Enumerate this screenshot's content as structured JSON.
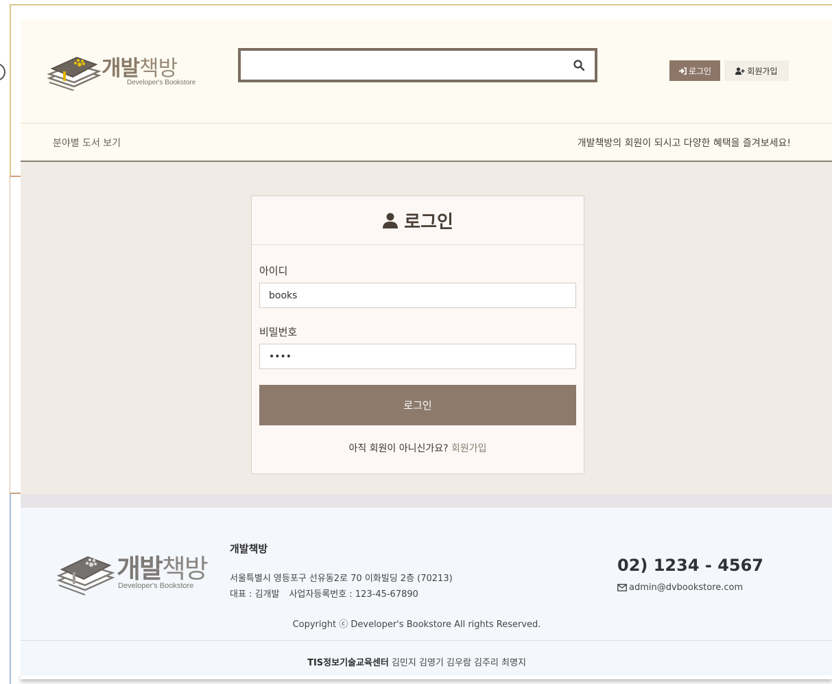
{
  "header": {
    "logo": {
      "title_bold": "개발",
      "title_light": "책방",
      "subtitle": "Developer's Bookstore"
    },
    "search": {
      "value": "",
      "placeholder": ""
    },
    "login_label": "로그인",
    "join_label": "회원가입",
    "nav": {
      "category_link": "분야별 도서 보기",
      "promo": "개발책방의 회원이 되시고 다양한 혜택을 즐겨보세요!"
    }
  },
  "login_card": {
    "title": "로그인",
    "id_label": "아이디",
    "id_value": "books",
    "password_label": "비밀번호",
    "password_value": "1234",
    "submit_label": "로그인",
    "signup_prompt": "아직 회원이 아니신가요?",
    "signup_link": "회원가입"
  },
  "footer": {
    "logo": {
      "title_bold": "개발",
      "title_light": "책방",
      "subtitle": "Developer's Bookstore"
    },
    "company": "개발책방",
    "address": "서울특별시 영등포구 선유동2로 70 이화빌딩 2층 (70213)",
    "representative": "대표 : 김개발",
    "business_number": "사업자등록번호 : 123-45-67890",
    "phone": "02) 1234 - 4567",
    "email": "admin@dvbookstore.com",
    "copyright": "Copyright ⓒ Developer's Bookstore All rights Reserved.",
    "credits_org": "TIS정보기술교육센터",
    "credits_names": "김민지 김영기 김우람 김주리 최명지"
  },
  "colors": {
    "brand_brown": "#8d7667",
    "header_bg": "#fefcf2",
    "main_bg": "#f1ebe6",
    "footer_bg": "#f4f7fb"
  }
}
